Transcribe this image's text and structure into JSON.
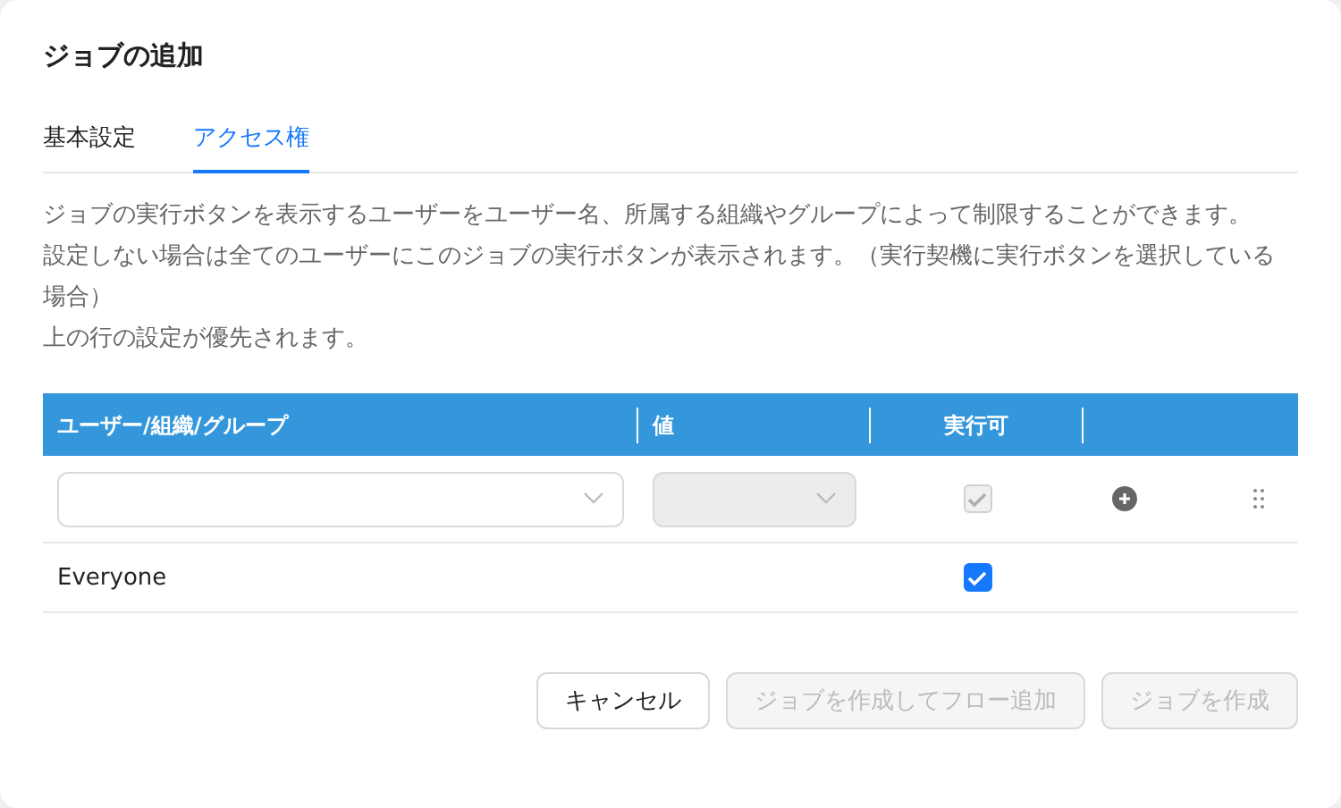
{
  "dialog": {
    "title": "ジョブの追加"
  },
  "tabs": [
    {
      "label": "基本設定",
      "selected": false
    },
    {
      "label": "アクセス権",
      "selected": true
    }
  ],
  "description": [
    "ジョブの実行ボタンを表示するユーザーをユーザー名、所属する組織やグループによって制限することができます。",
    "設定しない場合は全てのユーザーにこのジョブの実行ボタンが表示されます。（実行契機に実行ボタンを選択している場合）",
    "上の行の設定が優先されます。"
  ],
  "table": {
    "columns": [
      "ユーザー/組織/グループ",
      "値",
      "実行可"
    ],
    "new_row": {
      "value_disabled": true,
      "allowed": {
        "checked": true,
        "disabled": true
      }
    },
    "rows": [
      {
        "name": "Everyone",
        "allowed": {
          "checked": true,
          "disabled": false
        }
      }
    ]
  },
  "buttons": [
    {
      "label": "キャンセル",
      "disabled": false
    },
    {
      "label": "ジョブを作成してフロー追加",
      "disabled": true
    },
    {
      "label": "ジョブを作成",
      "disabled": true
    }
  ]
}
